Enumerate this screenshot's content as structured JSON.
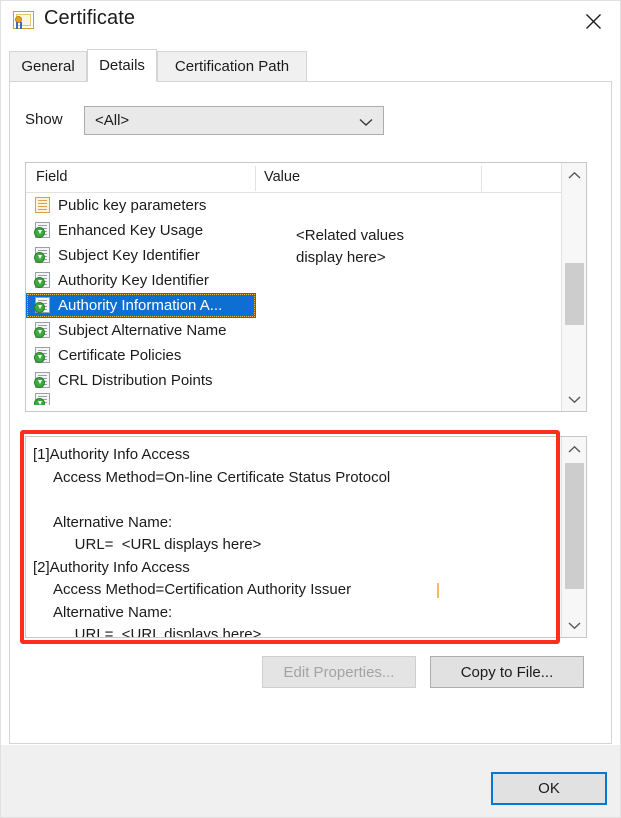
{
  "window": {
    "title": "Certificate",
    "icon": "certificate-icon",
    "close_label": "✕"
  },
  "tabs": [
    {
      "label": "General",
      "active": false
    },
    {
      "label": "Details",
      "active": true
    },
    {
      "label": "Certification Path",
      "active": false
    }
  ],
  "show": {
    "label": "Show",
    "selected": "<All>",
    "options": [
      "<All>"
    ]
  },
  "field_list": {
    "columns": [
      "Field",
      "Value"
    ],
    "value_text": "<Related values\ndisplay here>",
    "rows": [
      {
        "name": "Public key parameters",
        "icon": "certificate-field-icon",
        "icon_style": "tan",
        "selected": false
      },
      {
        "name": "Enhanced Key Usage",
        "icon": "certificate-extension-icon",
        "icon_style": "green",
        "selected": false
      },
      {
        "name": "Subject Key Identifier",
        "icon": "certificate-extension-icon",
        "icon_style": "green",
        "selected": false
      },
      {
        "name": "Authority Key Identifier",
        "icon": "certificate-extension-icon",
        "icon_style": "green",
        "selected": false
      },
      {
        "name": "Authority Information A...",
        "icon": "certificate-extension-icon",
        "icon_style": "green",
        "selected": true
      },
      {
        "name": "Subject Alternative Name",
        "icon": "certificate-extension-icon",
        "icon_style": "green",
        "selected": false
      },
      {
        "name": "Certificate Policies",
        "icon": "certificate-extension-icon",
        "icon_style": "green",
        "selected": false
      },
      {
        "name": "CRL Distribution Points",
        "icon": "certificate-extension-icon",
        "icon_style": "green",
        "selected": false
      }
    ]
  },
  "detail": {
    "text": "[1]Authority Info Access\n     Access Method=On-line Certificate Status Protocol\n\n     Alternative Name:\n          URL=  <URL displays here>\n[2]Authority Info Access\n     Access Method=Certification Authority Issuer\n     Alternative Name:\n          URL=  <URL displays here>"
  },
  "buttons": {
    "edit_properties": "Edit Properties...",
    "copy_to_file": "Copy to File...",
    "ok": "OK"
  },
  "annotation": {
    "color": "#ff2d20",
    "target": "detail-text-box"
  },
  "colors": {
    "selection_blue": "#0d6fd1",
    "focus_blue": "#0078d7",
    "dialog_gray": "#f0f0f0",
    "annotation_red": "#ff2d20"
  }
}
